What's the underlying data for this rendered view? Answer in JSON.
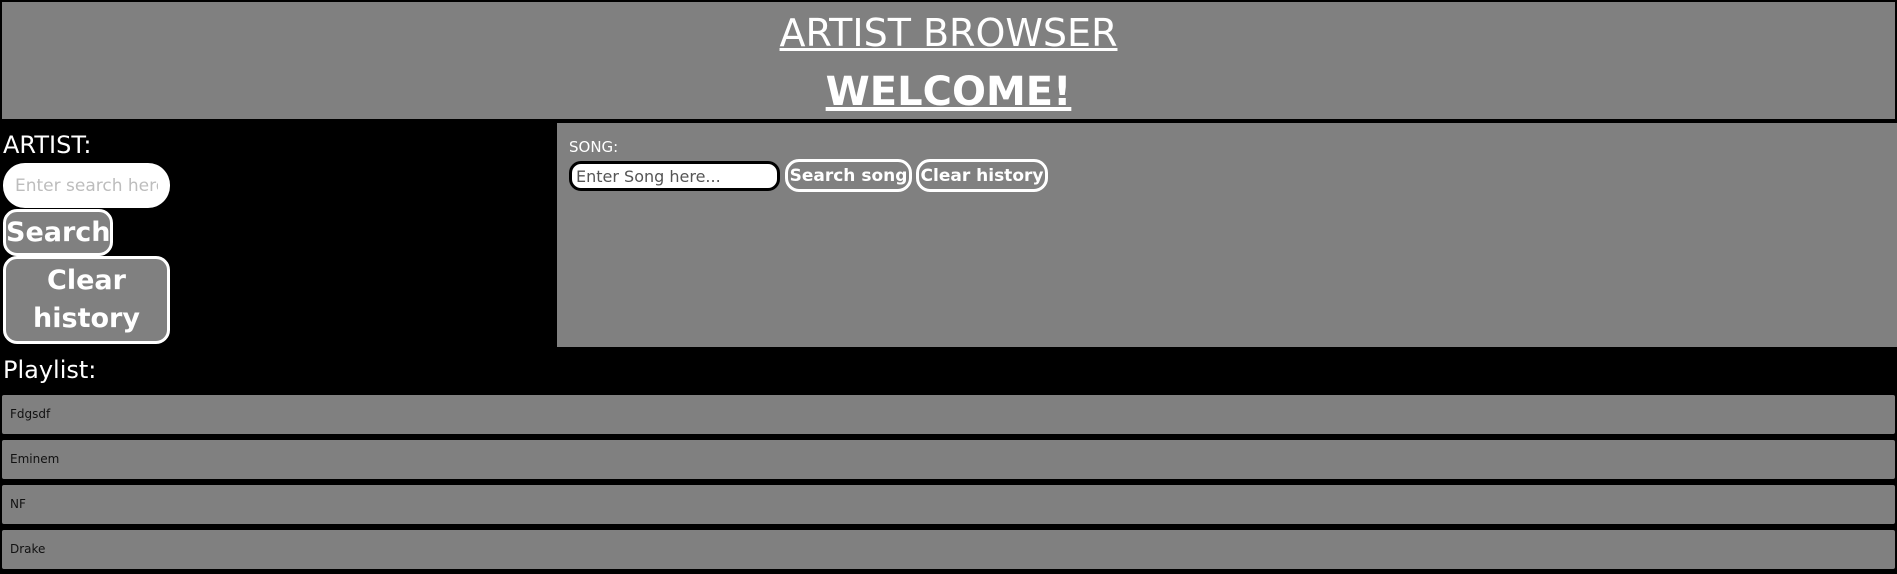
{
  "header": {
    "title": "ARTIST BROWSER",
    "welcome": "WELCOME!"
  },
  "artist": {
    "label": "ARTIST:",
    "placeholder": "Enter search here.",
    "search_label": "Search",
    "clear_label": "Clear history"
  },
  "song": {
    "label": "SONG:",
    "placeholder": "Enter Song here...",
    "search_label": "Search song",
    "clear_label": "Clear history"
  },
  "playlist": {
    "label": "Playlist:",
    "items": [
      "Fdgsdf",
      "Eminem",
      "NF",
      "Drake"
    ]
  },
  "colors": {
    "background": "#000000",
    "panel": "#808080",
    "text": "#ffffff"
  }
}
